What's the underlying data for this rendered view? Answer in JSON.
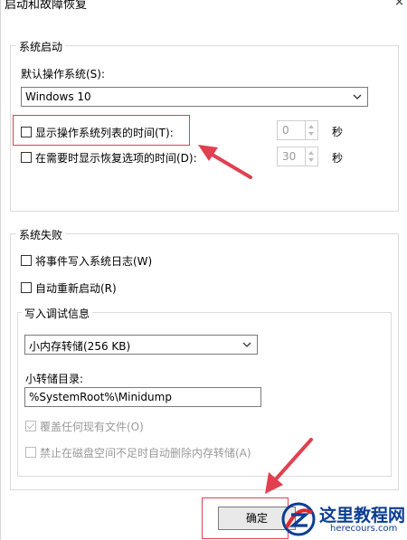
{
  "window": {
    "title": "启动和故障恢复",
    "close_glyph": "×"
  },
  "startup": {
    "group_title": "系统启动",
    "default_os_label": "默认操作系统(S):",
    "default_os_value": "Windows 10",
    "show_list_label": "显示操作系统列表的时间(T):",
    "show_list_value": "0",
    "show_list_unit": "秒",
    "show_recovery_label": "在需要时显示恢复选项的时间(D):",
    "show_recovery_value": "30",
    "show_recovery_unit": "秒"
  },
  "failure": {
    "group_title": "系统失败",
    "write_log_label": "将事件写入系统日志(W)",
    "auto_restart_label": "自动重新启动(R)",
    "debug_group_title": "写入调试信息",
    "debug_type_value": "小内存转储(256 KB)",
    "dump_dir_label": "小转储目录:",
    "dump_dir_value": "%SystemRoot%\\Minidump",
    "overwrite_label": "覆盖任何现有文件(O)",
    "disable_delete_label": "禁止在磁盘空间不足时自动删除内存转储(A)"
  },
  "buttons": {
    "ok_label": "确定"
  },
  "watermark": {
    "name": "这里教程网",
    "url": "herecours.com"
  },
  "colors": {
    "annotation_red": "#e04050",
    "watermark_blue": "#0b3d91"
  },
  "icons": [
    "close-icon",
    "chevron-down-icon",
    "spin-up-icon",
    "spin-down-icon",
    "checkbox-icon",
    "annotation-arrow-icon",
    "watermark-logo-icon"
  ]
}
